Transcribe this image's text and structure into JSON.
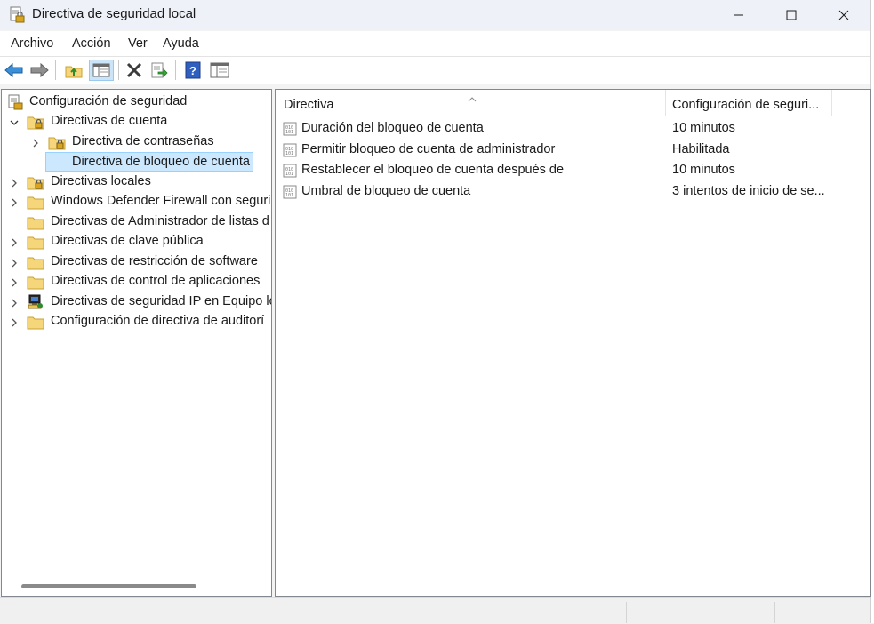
{
  "window": {
    "title": "Directiva de seguridad local"
  },
  "menu": {
    "items": [
      "Archivo",
      "Acción",
      "Ver",
      "Ayuda"
    ]
  },
  "toolbar": {
    "buttons": [
      "back-icon",
      "forward-icon",
      "up-folder-icon",
      "show-hide-tree-icon",
      "delete-icon",
      "export-list-icon",
      "help-icon",
      "properties-icon"
    ]
  },
  "tree": {
    "root": "Configuración de seguridad",
    "items": [
      "Directivas de cuenta",
      "Directiva de contraseñas",
      "Directiva de bloqueo de cuenta",
      "Directivas locales",
      "Windows Defender Firewall con seguri",
      "Directivas de Administrador de listas d",
      "Directivas de clave pública",
      "Directivas de restricción de software",
      "Directivas de control de aplicaciones",
      "Directivas de seguridad IP en Equipo lo",
      "Configuración de directiva de auditorí"
    ],
    "selected": "Directiva de bloqueo de cuenta"
  },
  "list": {
    "columns": [
      "Directiva",
      "Configuración de seguri..."
    ],
    "rows": [
      {
        "name": "Duración del bloqueo de cuenta",
        "value": "10 minutos"
      },
      {
        "name": "Permitir bloqueo de cuenta de administrador",
        "value": "Habilitada"
      },
      {
        "name": "Restablecer el bloqueo de cuenta después de",
        "value": "10 minutos"
      },
      {
        "name": "Umbral de bloqueo de cuenta",
        "value": "3 intentos de inicio de se..."
      }
    ]
  },
  "colors": {
    "selection_bg": "#cce8ff",
    "selection_border": "#99d1ff",
    "folder": "#f5d67b"
  }
}
